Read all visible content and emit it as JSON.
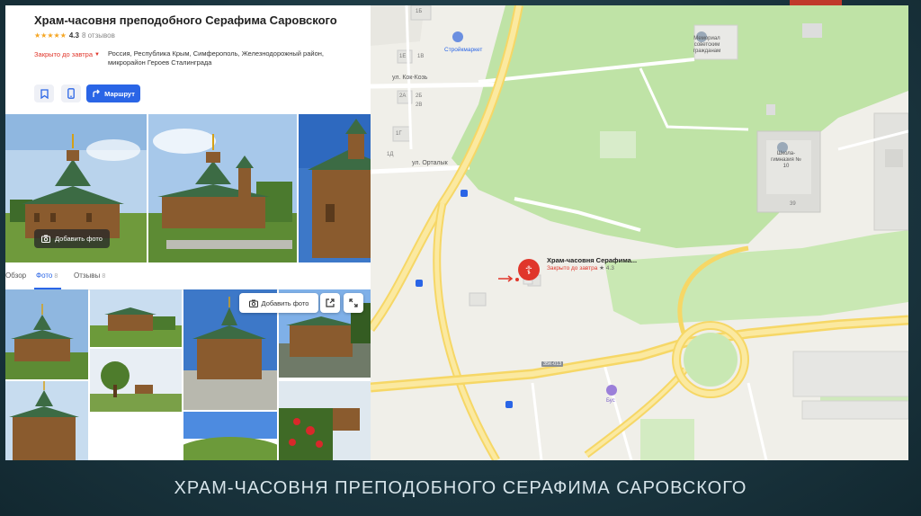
{
  "slide": {
    "caption": "ХРАМ-ЧАСОВНЯ ПРЕПОДОБНОГО СЕРАФИМА САРОВСКОГО",
    "accent_color": "#c0392b"
  },
  "org": {
    "title": "Храм-часовня преподобного Серафима Саровского",
    "stars": "★★★★★",
    "rating": "4.3",
    "reviews": "8 отзывов",
    "status": "Закрыто до завтра",
    "address": "Россия, Республика Крым, Симферополь, Железнодорожный район, микрорайон Героев Сталинграда"
  },
  "actions": {
    "bookmark_icon": "bookmark-icon",
    "phone_icon": "phone-icon",
    "route_label": "Маршрут"
  },
  "photos": {
    "add_photo_label": "Добавить фото"
  },
  "tabs": [
    {
      "label": "Обзор",
      "count": ""
    },
    {
      "label": "Фото",
      "count": "8"
    },
    {
      "label": "Отзывы",
      "count": "8"
    }
  ],
  "gallery": {
    "add_photo_label": "Добавить фото",
    "share_icon": "external-link-icon",
    "expand_icon": "expand-icon"
  },
  "map": {
    "streets": [
      "ул. Кок-Козь",
      "ул. Орталык"
    ],
    "pois": {
      "store": "Стройкмаркет",
      "memorial": "Мемориал советским гражданам",
      "school": "Школа-гимназия № 10",
      "bus_stop": "Бус"
    },
    "house_numbers": [
      "1Б",
      "1Е",
      "1В",
      "2А",
      "2Б",
      "2В",
      "1Г",
      "1Д",
      "39"
    ],
    "road_sign": "35К-013",
    "marker": {
      "name": "Храм-часовня Серафима...",
      "status": "Закрыто до завтра",
      "rating": "4.3"
    }
  }
}
